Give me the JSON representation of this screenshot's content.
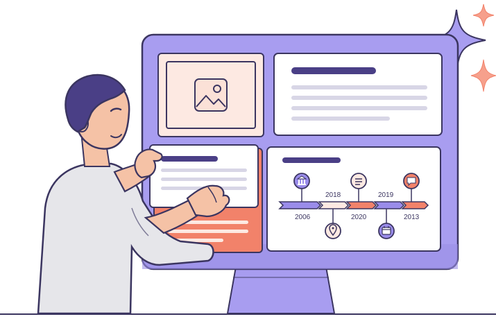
{
  "illustration": {
    "timeline": {
      "years_top": [
        "2018",
        "2019"
      ],
      "years_bottom": [
        "2006",
        "2020",
        "2013"
      ],
      "milestone_icons": [
        "bank-icon",
        "map-pin-icon",
        "list-icon",
        "calendar-icon",
        "chat-icon"
      ]
    },
    "colors": {
      "monitor_frame": "#a89df0",
      "stand": "#a89df0",
      "card": "#ffffff",
      "outline": "#3b3560",
      "accent_coral": "#f2826a",
      "accent_purple": "#9a8cea",
      "heading_bar": "#4a3f86",
      "text_line": "#d8d6e6",
      "image_tile": "#fde9e2",
      "shirt": "#e6e6ea",
      "hair": "#4a3f86",
      "skin": "#f5c2a6"
    }
  }
}
